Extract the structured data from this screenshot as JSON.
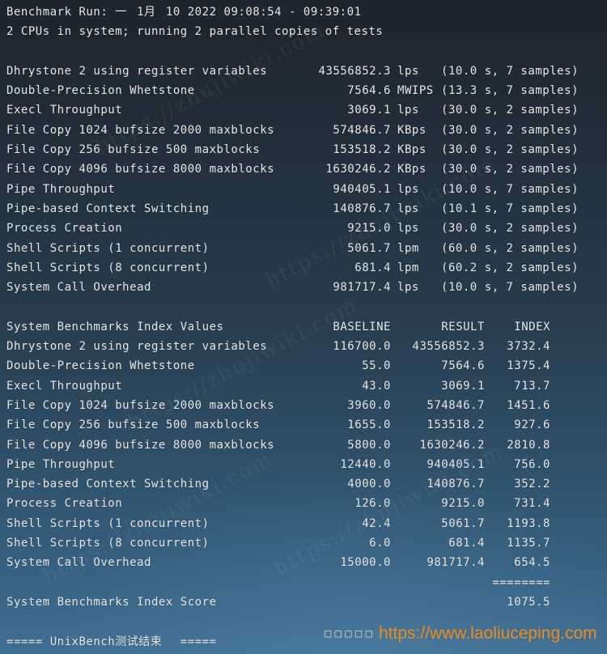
{
  "terminal": {
    "run": {
      "label": "Benchmark Run:",
      "weekday": "一",
      "month": "1月",
      "day_year": "10 2022",
      "time_range": "09:08:54 - 09:39:01"
    },
    "system_info": "2 CPUs in system; running 2 parallel copies of tests",
    "results": [
      {
        "name": "Dhrystone 2 using register variables",
        "value": "43556852.3",
        "unit": "lps",
        "run": "(10.0 s, 7 samples)"
      },
      {
        "name": "Double-Precision Whetstone",
        "value": "7564.6",
        "unit": "MWIPS",
        "run": "(13.3 s, 7 samples)"
      },
      {
        "name": "Execl Throughput",
        "value": "3069.1",
        "unit": "lps",
        "run": "(30.0 s, 2 samples)"
      },
      {
        "name": "File Copy 1024 bufsize 2000 maxblocks",
        "value": "574846.7",
        "unit": "KBps",
        "run": "(30.0 s, 2 samples)"
      },
      {
        "name": "File Copy 256 bufsize 500 maxblocks",
        "value": "153518.2",
        "unit": "KBps",
        "run": "(30.0 s, 2 samples)"
      },
      {
        "name": "File Copy 4096 bufsize 8000 maxblocks",
        "value": "1630246.2",
        "unit": "KBps",
        "run": "(30.0 s, 2 samples)"
      },
      {
        "name": "Pipe Throughput",
        "value": "940405.1",
        "unit": "lps",
        "run": "(10.0 s, 7 samples)"
      },
      {
        "name": "Pipe-based Context Switching",
        "value": "140876.7",
        "unit": "lps",
        "run": "(10.1 s, 7 samples)"
      },
      {
        "name": "Process Creation",
        "value": "9215.0",
        "unit": "lps",
        "run": "(30.0 s, 2 samples)"
      },
      {
        "name": "Shell Scripts (1 concurrent)",
        "value": "5061.7",
        "unit": "lpm",
        "run": "(60.0 s, 2 samples)"
      },
      {
        "name": "Shell Scripts (8 concurrent)",
        "value": "681.4",
        "unit": "lpm",
        "run": "(60.2 s, 2 samples)"
      },
      {
        "name": "System Call Overhead",
        "value": "981717.4",
        "unit": "lps",
        "run": "(10.0 s, 7 samples)"
      }
    ],
    "index_table": {
      "title": "System Benchmarks Index Values",
      "columns": [
        "BASELINE",
        "RESULT",
        "INDEX"
      ],
      "rows": [
        {
          "name": "Dhrystone 2 using register variables",
          "baseline": "116700.0",
          "result": "43556852.3",
          "index": "3732.4"
        },
        {
          "name": "Double-Precision Whetstone",
          "baseline": "55.0",
          "result": "7564.6",
          "index": "1375.4"
        },
        {
          "name": "Execl Throughput",
          "baseline": "43.0",
          "result": "3069.1",
          "index": "713.7"
        },
        {
          "name": "File Copy 1024 bufsize 2000 maxblocks",
          "baseline": "3960.0",
          "result": "574846.7",
          "index": "1451.6"
        },
        {
          "name": "File Copy 256 bufsize 500 maxblocks",
          "baseline": "1655.0",
          "result": "153518.2",
          "index": "927.6"
        },
        {
          "name": "File Copy 4096 bufsize 8000 maxblocks",
          "baseline": "5800.0",
          "result": "1630246.2",
          "index": "2810.8"
        },
        {
          "name": "Pipe Throughput",
          "baseline": "12440.0",
          "result": "940405.1",
          "index": "756.0"
        },
        {
          "name": "Pipe-based Context Switching",
          "baseline": "4000.0",
          "result": "140876.7",
          "index": "352.2"
        },
        {
          "name": "Process Creation",
          "baseline": "126.0",
          "result": "9215.0",
          "index": "731.4"
        },
        {
          "name": "Shell Scripts (1 concurrent)",
          "baseline": "42.4",
          "result": "5061.7",
          "index": "1193.8"
        },
        {
          "name": "Shell Scripts (8 concurrent)",
          "baseline": "6.0",
          "result": "681.4",
          "index": "1135.7"
        },
        {
          "name": "System Call Overhead",
          "baseline": "15000.0",
          "result": "981717.4",
          "index": "654.5"
        }
      ],
      "separator": "========",
      "score_label": "System Benchmarks Index Score",
      "score": "1075.5"
    },
    "footer": {
      "left": "=====",
      "title": "UnixBench测试结束",
      "right": "====="
    }
  },
  "watermark": {
    "tofu": "□□□□□",
    "url": "https://www.laoliuceping.com",
    "background_text": "https://zhujiwiki.com"
  },
  "colors": {
    "text": "#e8e8e8",
    "watermark_url": "#f0891f",
    "watermark_tofu": "#d6d6d6",
    "background_top": "#1d252e",
    "background_bottom": "#3f6f93"
  }
}
